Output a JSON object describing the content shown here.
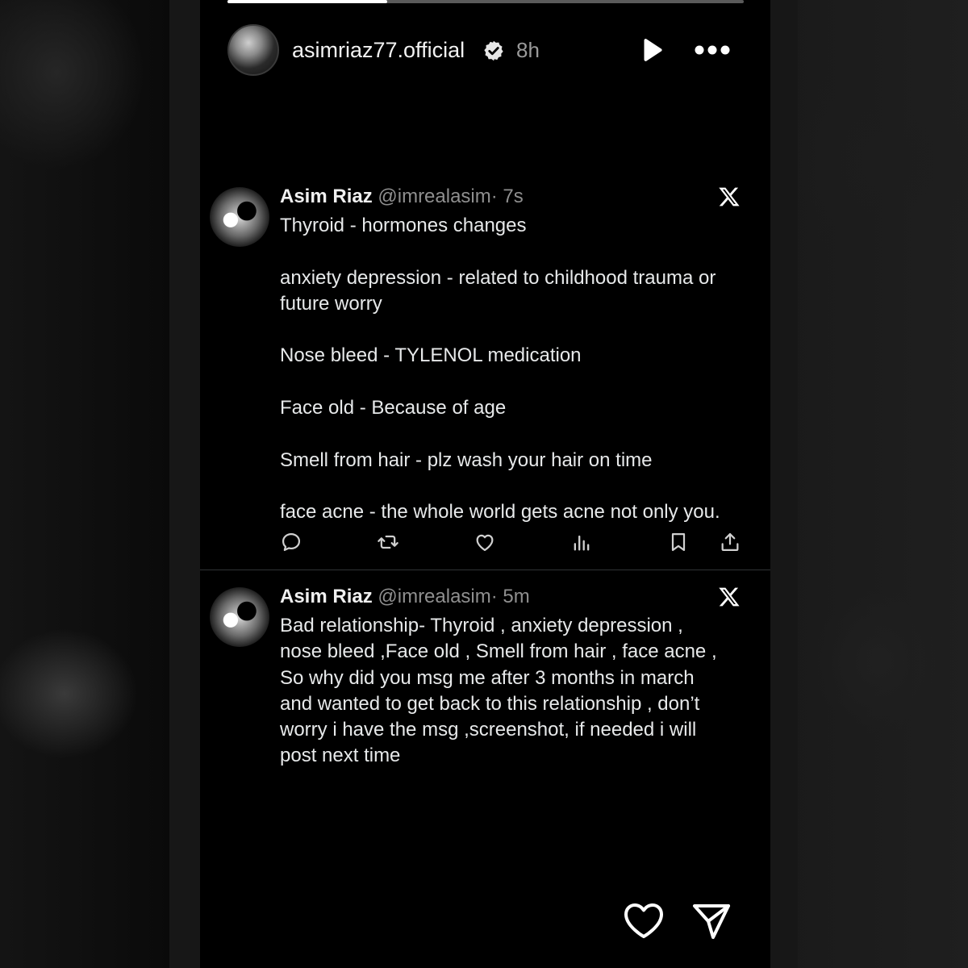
{
  "story": {
    "progress": 0.31,
    "username": "asimriaz77.official",
    "time": "8h",
    "icons": {
      "verified": "verified-badge-icon",
      "play": "play-icon",
      "more": "more-dots-icon"
    }
  },
  "tweets": [
    {
      "name": "Asim Riaz",
      "handle": "@imrealasim",
      "time": "· 7s",
      "paragraphs": [
        "Thyroid - hormones changes",
        "anxiety depression - related to childhood trauma or future worry",
        "Nose bleed - TYLENOL medication",
        "Face old - Because of age",
        "Smell from hair - plz wash your hair on time",
        "face acne - the whole world gets acne not only you."
      ],
      "actions": [
        "reply-icon",
        "retweet-icon",
        "like-icon",
        "views-icon",
        "bookmark-icon",
        "share-icon"
      ]
    },
    {
      "name": "Asim Riaz",
      "handle": "@imrealasim",
      "time": "· 5m",
      "lines": [
        "Bad relationship- Thyroid , anxiety depression ,",
        "nose bleed ,Face old , Smell from hair , face acne ,",
        "So why did you msg me after 3 months in march",
        "and wanted to get back to this relationship , don’t",
        "worry i have the msg ,screenshot, if needed i will",
        "post next time"
      ]
    }
  ],
  "footer": {
    "icons": [
      "heart-icon",
      "send-icon"
    ]
  },
  "colors": {
    "background": "#000000",
    "text": "#e7e9ea",
    "muted": "#8f8f8f",
    "divider": "#2f3336"
  }
}
